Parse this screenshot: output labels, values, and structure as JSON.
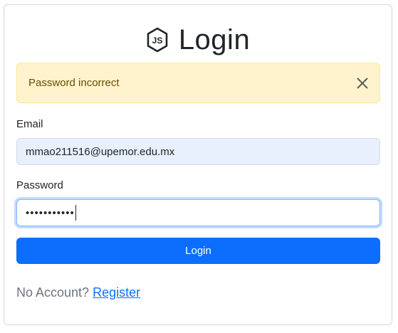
{
  "header": {
    "logo_icon": "nodejs-hexagon-icon",
    "title": "Login"
  },
  "alert": {
    "message": "Password incorrect",
    "close_icon": "close-icon",
    "background": "#fff3cd",
    "text_color": "#664d03"
  },
  "form": {
    "email_label": "Email",
    "email_value": "mmao211516@upemor.edu.mx",
    "password_label": "Password",
    "password_value": "•••••••••••",
    "submit_label": "Login"
  },
  "footer": {
    "prompt": "No Account?",
    "register_link": "Register"
  },
  "colors": {
    "primary": "#0d6efd",
    "autofill_bg": "#e8f0fe"
  }
}
